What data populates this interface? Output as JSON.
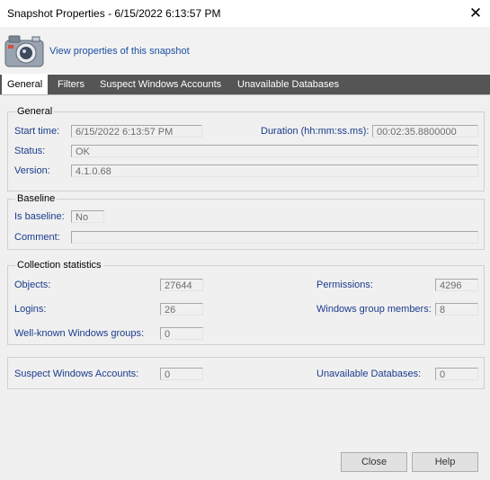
{
  "window": {
    "title": "Snapshot Properties - 6/15/2022 6:13:57 PM",
    "close_glyph": "✕"
  },
  "header": {
    "icon": "camera-icon",
    "link": "View properties of this snapshot"
  },
  "tabs": [
    "General",
    "Filters",
    "Suspect Windows Accounts",
    "Unavailable Databases"
  ],
  "general": {
    "legend": "General",
    "start_time_label": "Start time:",
    "start_time": "6/15/2022 6:13:57 PM",
    "duration_label": "Duration (hh:mm:ss.ms):",
    "duration": "00:02:35.8800000",
    "status_label": "Status:",
    "status": "OK",
    "version_label": "Version:",
    "version": "4.1.0.68"
  },
  "baseline": {
    "legend": "Baseline",
    "is_baseline_label": "Is baseline:",
    "is_baseline": "No",
    "comment_label": "Comment:",
    "comment": ""
  },
  "stats": {
    "legend": "Collection statistics",
    "objects_label": "Objects:",
    "objects": "27644",
    "permissions_label": "Permissions:",
    "permissions": "4296",
    "logins_label": "Logins:",
    "logins": "26",
    "win_group_members_label": "Windows group members:",
    "win_group_members": "8",
    "well_known_label": "Well-known Windows groups:",
    "well_known": "0"
  },
  "suspect": {
    "suspect_label": "Suspect Windows Accounts:",
    "suspect": "0",
    "unavailable_label": "Unavailable Databases:",
    "unavailable": "0"
  },
  "buttons": {
    "close": "Close",
    "help": "Help"
  }
}
